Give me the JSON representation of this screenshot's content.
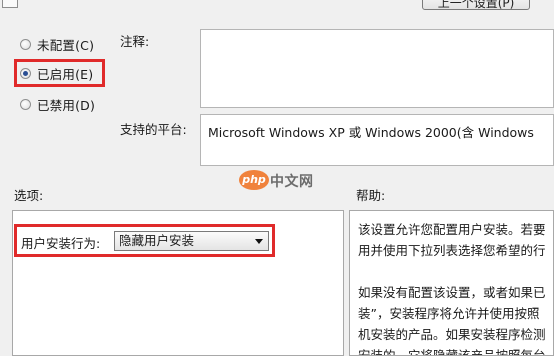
{
  "toolbar": {
    "prev_setting_label": "上一个设置(P)"
  },
  "state_options": [
    {
      "label": "未配置(C)",
      "selected": false
    },
    {
      "label": "已启用(E)",
      "selected": true
    },
    {
      "label": "已禁用(D)",
      "selected": false
    }
  ],
  "comment": {
    "label": "注释:",
    "value": ""
  },
  "platform": {
    "label": "支持的平台:",
    "value": "Microsoft Windows XP 或 Windows 2000(含 Windows"
  },
  "options_section": {
    "label": "选项:"
  },
  "help_section": {
    "label": "帮助:"
  },
  "install_behavior": {
    "label": "用户安装行为:",
    "selected": "隐藏用户安装"
  },
  "help_text": [
    "该设置允许您配置用户安装。若要",
    "用并使用下拉列表选择您希望的行",
    "",
    "如果没有配置该设置，或者如果已",
    "装”，安装程序将允许并使用按照",
    "机安装的产品。如果安装程序检测",
    "安装的，它将隐藏该产品按照每台"
  ],
  "watermark": {
    "logo": "php",
    "text": "中文网"
  },
  "colors": {
    "highlight": "#e02a2a",
    "window_bg": "#f0f0f0",
    "watermark": "#f0823c"
  }
}
